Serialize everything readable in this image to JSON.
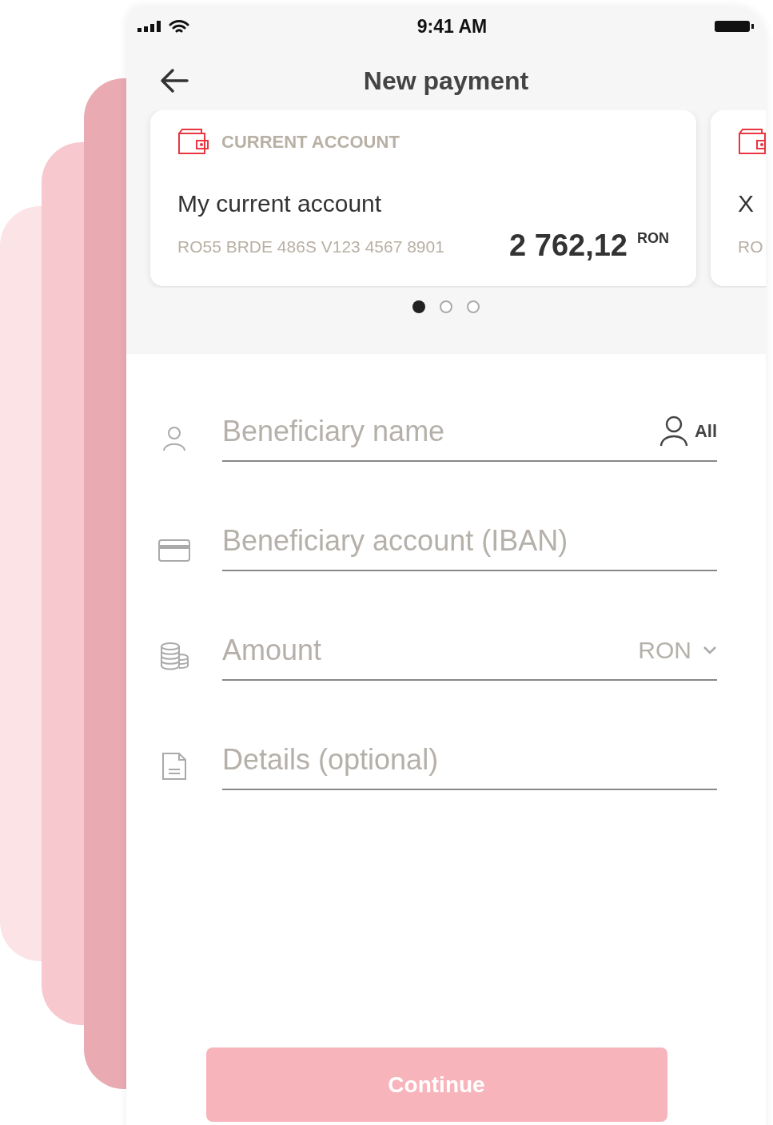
{
  "status_bar": {
    "time": "9:41 AM"
  },
  "header": {
    "title": "New payment"
  },
  "accounts": [
    {
      "type_label": "CURRENT ACCOUNT",
      "name": "My current account",
      "iban": "RO55 BRDE 486S V123 4567 8901",
      "balance": "2 762,12",
      "currency": "RON"
    },
    {
      "name": "X",
      "iban": "RO"
    }
  ],
  "pager": [
    {
      "selected": true
    },
    {
      "selected": false
    },
    {
      "selected": false
    }
  ],
  "fields": [
    {
      "kind": "person",
      "placeholder": "Beneficiary name",
      "accessory": {
        "kind": "contacts",
        "label": "All"
      }
    },
    {
      "kind": "card",
      "placeholder": "Beneficiary account (IBAN)"
    },
    {
      "kind": "coins",
      "placeholder": "Amount",
      "accessory": {
        "kind": "currency",
        "label": "RON"
      }
    },
    {
      "kind": "document",
      "placeholder": "Details (optional)"
    }
  ],
  "continue_button": {
    "label": "Continue",
    "disabled": true
  }
}
